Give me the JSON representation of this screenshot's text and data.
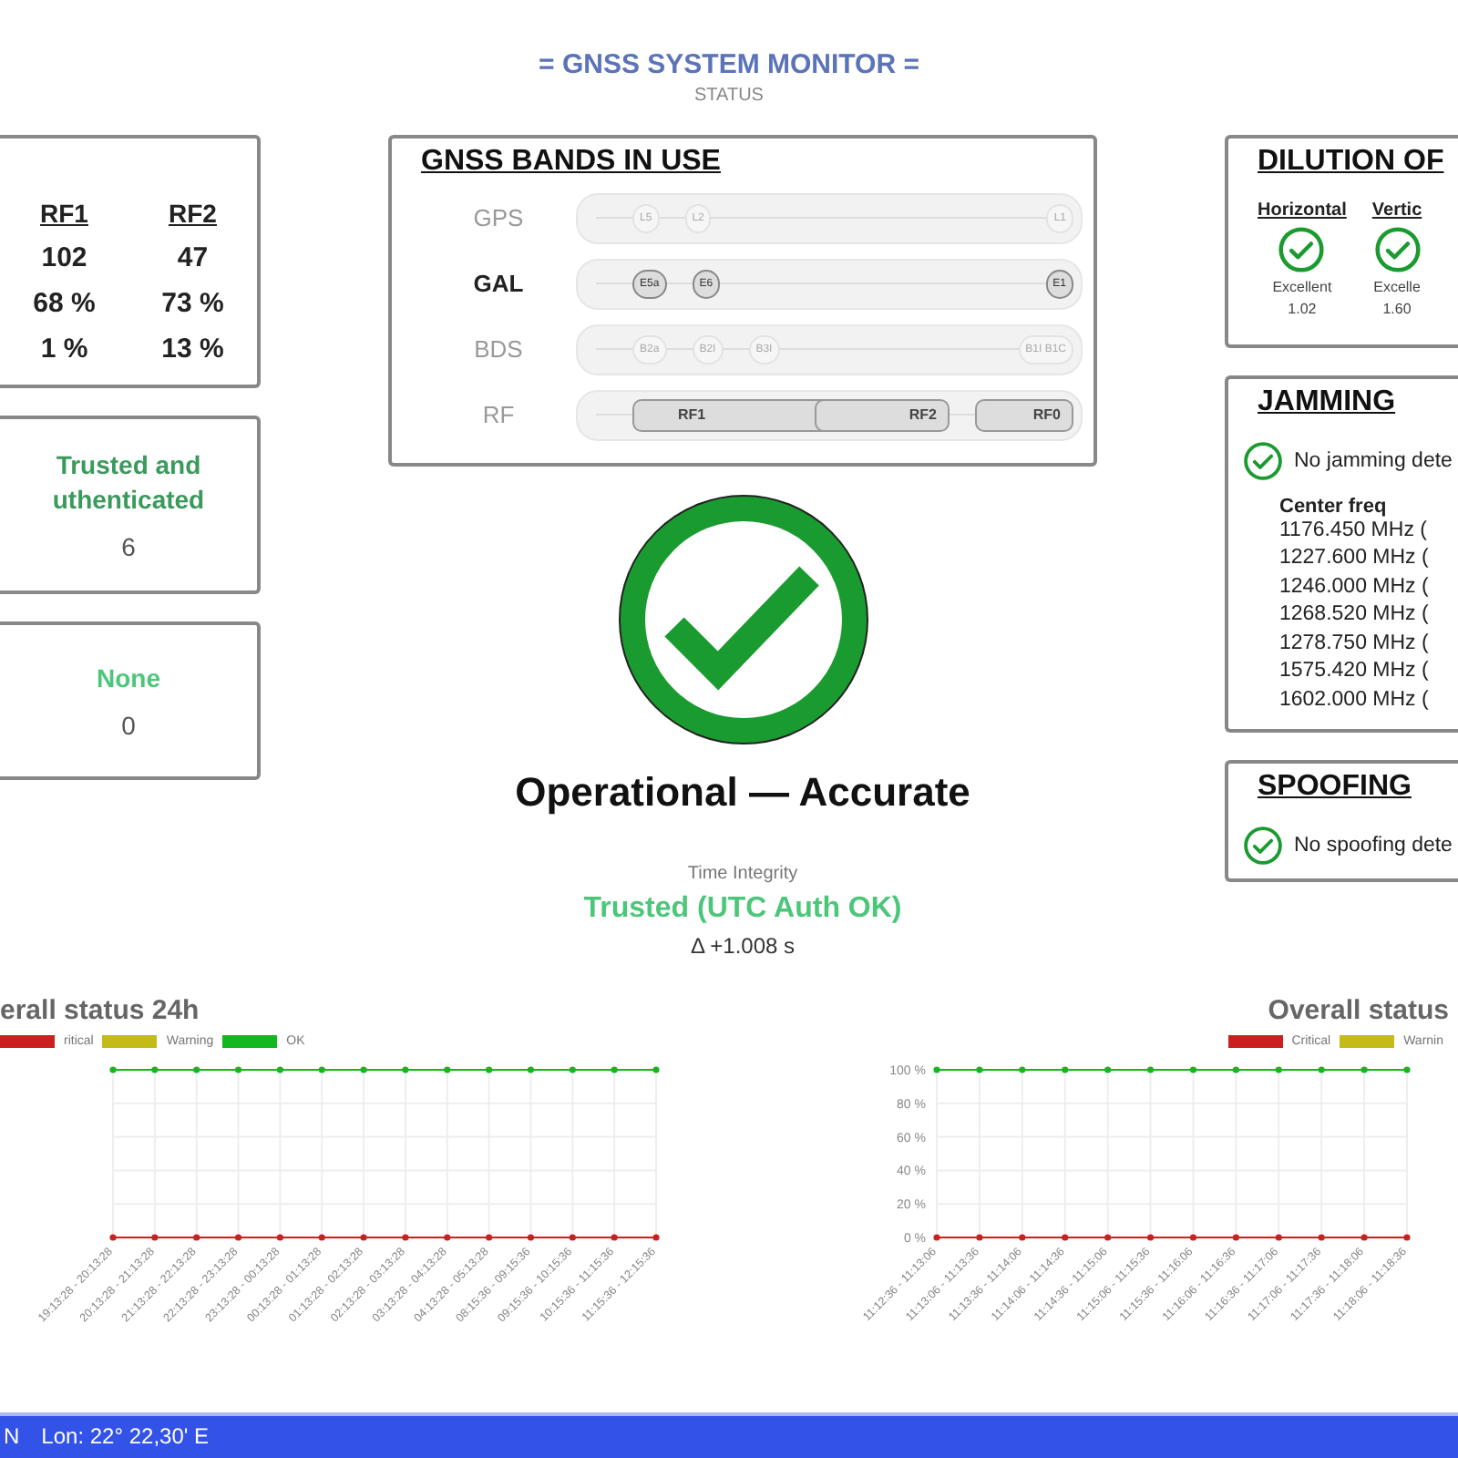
{
  "header": {
    "title": "= GNSS SYSTEM MONITOR =",
    "subtitle": "STATUS"
  },
  "left_cards": [
    {
      "kind": "table",
      "columns": [
        "RF1",
        "RF2"
      ],
      "rows": [
        [
          "102",
          "47"
        ],
        [
          "68 %",
          "73 %"
        ],
        [
          "1 %",
          "13 %"
        ]
      ]
    },
    {
      "kind": "status",
      "status": "Trusted and\nuthenticated",
      "count": "6",
      "color": "#3a9a5c"
    },
    {
      "kind": "status",
      "status": "None",
      "count": "0",
      "color": "#4cc77a"
    }
  ],
  "bands": {
    "title": "GNSS BANDS IN USE",
    "rows": [
      {
        "label": "GPS",
        "active": false,
        "kind": "dots",
        "chips": [
          {
            "label": "L5",
            "active": false
          },
          {
            "label": "L2",
            "active": false
          },
          {
            "label": "L1",
            "active": false
          }
        ]
      },
      {
        "label": "GAL",
        "active": true,
        "kind": "dots",
        "chips": [
          {
            "label": "E5a",
            "active": true
          },
          {
            "label": "E6",
            "active": true
          },
          {
            "label": "E1",
            "active": true
          }
        ]
      },
      {
        "label": "BDS",
        "active": false,
        "kind": "dots",
        "chips": [
          {
            "label": "B2a",
            "active": false
          },
          {
            "label": "B2I",
            "active": false
          },
          {
            "label": "B3I",
            "active": false
          },
          {
            "label": "B1I B1C",
            "active": false
          }
        ]
      },
      {
        "label": "RF",
        "active": false,
        "kind": "bars",
        "chips": [
          {
            "label": "RF1",
            "active": true
          },
          {
            "label": "RF2",
            "active": true
          },
          {
            "label": "RF0",
            "active": true
          }
        ]
      }
    ]
  },
  "overall": {
    "ok": true,
    "status": "Operational — Accurate",
    "time_label": "Time Integrity",
    "time_status": "Trusted (UTC Auth OK)",
    "delta": "Δ +1.008 s"
  },
  "dilution": {
    "title": "DILUTION OF",
    "items": [
      {
        "label": "Horizontal",
        "ok": true,
        "rating": "Excellent",
        "value": "1.02"
      },
      {
        "label": "Vertic",
        "ok": true,
        "rating": "Excelle",
        "value": "1.60"
      }
    ]
  },
  "jamming": {
    "title": "JAMMING",
    "ok": true,
    "message": "No jamming dete",
    "list_title": "Center freq",
    "frequencies": [
      "1176.450 MHz (",
      "1227.600 MHz (",
      "1246.000 MHz (",
      "1268.520 MHz (",
      "1278.750 MHz (",
      "1575.420 MHz (",
      "1602.000 MHz ("
    ]
  },
  "spoofing": {
    "title": "SPOOFING",
    "ok": true,
    "message": "No spoofing dete"
  },
  "charts": [
    {
      "chart_data": {
        "type": "line",
        "title": "erall status 24h",
        "categories": [
          "19:13:28 - 20:13:28",
          "20:13:28 - 21:13:28",
          "21:13:28 - 22:13:28",
          "22:13:28 - 23:13:28",
          "23:13:28 - 00:13:28",
          "00:13:28 - 01:13:28",
          "01:13:28 - 02:13:28",
          "02:13:28 - 03:13:28",
          "03:13:28 - 04:13:28",
          "04:13:28 - 05:13:28",
          "08:15:36 - 09:15:36",
          "09:15:36 - 10:15:36",
          "10:15:36 - 11:15:36",
          "11:15:36 - 12:15:36"
        ],
        "ylim": [
          0,
          100
        ],
        "series": [
          {
            "name": "ritical",
            "color": "#cc1f1f",
            "marker": true,
            "values": [
              0,
              0,
              0,
              0,
              0,
              0,
              0,
              0,
              0,
              0,
              0,
              0,
              0,
              0
            ]
          },
          {
            "name": "Warning",
            "color": "#c4bb16",
            "values": [
              null,
              null,
              null,
              null,
              null,
              null,
              null,
              null,
              null,
              null,
              null,
              null,
              null,
              null
            ]
          },
          {
            "name": "OK",
            "color": "#13b71f",
            "marker": true,
            "values": [
              100,
              100,
              100,
              100,
              100,
              100,
              100,
              100,
              100,
              100,
              100,
              100,
              100,
              100
            ]
          }
        ],
        "grid": true
      }
    },
    {
      "chart_data": {
        "type": "line",
        "title": "Overall status",
        "categories": [
          "11:12:36 - 11:13:06",
          "11:13:06 - 11:13:36",
          "11:13:36 - 11:14:06",
          "11:14:06 - 11:14:36",
          "11:14:36 - 11:15:06",
          "11:15:06 - 11:15:36",
          "11:15:36 - 11:16:06",
          "11:16:06 - 11:16:36",
          "11:16:36 - 11:17:06",
          "11:17:06 - 11:17:36",
          "11:17:36 - 11:18:06",
          "11:18:06 - 11:18:36"
        ],
        "ylim": [
          0,
          100
        ],
        "yticks": [
          {
            "value": 0,
            "label": "0 %"
          },
          {
            "value": 20,
            "label": "20 %"
          },
          {
            "value": 40,
            "label": "40 %"
          },
          {
            "value": 60,
            "label": "60 %"
          },
          {
            "value": 80,
            "label": "80 %"
          },
          {
            "value": 100,
            "label": "100 %"
          }
        ],
        "series": [
          {
            "name": "Critical",
            "color": "#cc1f1f",
            "marker": true,
            "values": [
              0,
              0,
              0,
              0,
              0,
              0,
              0,
              0,
              0,
              0,
              0,
              0
            ]
          },
          {
            "name": "Warnin",
            "color": "#c4bb16",
            "values": [
              null,
              null,
              null,
              null,
              null,
              null,
              null,
              null,
              null,
              null,
              null,
              null
            ]
          },
          {
            "color": "#13b71f",
            "marker": true,
            "values": [
              100,
              100,
              100,
              100,
              100,
              100,
              100,
              100,
              100,
              100,
              100,
              100
            ]
          }
        ],
        "grid": true
      }
    }
  ],
  "status_bar": {
    "items": [
      "N",
      "Lon: 22° 22,30' E"
    ]
  }
}
